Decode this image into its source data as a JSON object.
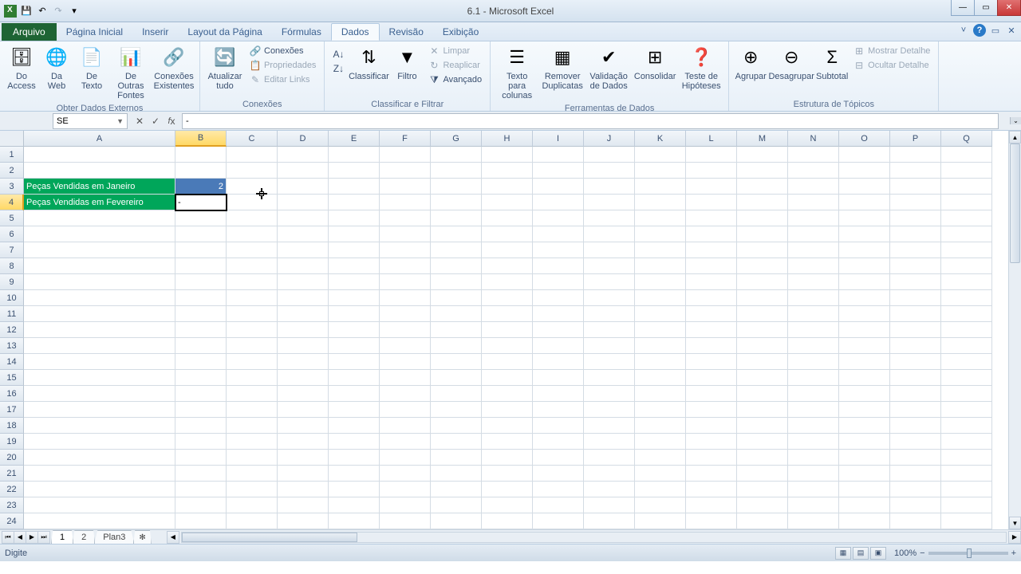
{
  "window": {
    "title": "6.1 - Microsoft Excel"
  },
  "qat": {
    "save": "💾",
    "undo": "↶",
    "redo": "↷"
  },
  "tabs": {
    "file": "Arquivo",
    "items": [
      "Página Inicial",
      "Inserir",
      "Layout da Página",
      "Fórmulas",
      "Dados",
      "Revisão",
      "Exibição"
    ],
    "active_index": 4
  },
  "ribbon": {
    "groups": [
      {
        "label": "Obter Dados Externos"
      },
      {
        "label": "Conexões"
      },
      {
        "label": "Classificar e Filtrar"
      },
      {
        "label": "Ferramentas de Dados"
      },
      {
        "label": "Estrutura de Tópicos"
      }
    ],
    "btns": {
      "do_access": "Do Access",
      "da_web": "Da Web",
      "de_texto": "De Texto",
      "de_outras": "De Outras Fontes",
      "conexoes_exist": "Conexões Existentes",
      "atualizar": "Atualizar tudo",
      "conexoes": "Conexões",
      "propriedades": "Propriedades",
      "editar_links": "Editar Links",
      "az": "A↓Z",
      "za": "Z↓A",
      "classificar": "Classificar",
      "filtro": "Filtro",
      "limpar": "Limpar",
      "reaplicar": "Reaplicar",
      "avancado": "Avançado",
      "texto_colunas": "Texto para colunas",
      "remover_dup": "Remover Duplicatas",
      "validacao": "Validação de Dados",
      "consolidar": "Consolidar",
      "teste_hip": "Teste de Hipóteses",
      "agrupar": "Agrupar",
      "desagrupar": "Desagrupar",
      "subtotal": "Subtotal",
      "mostrar_det": "Mostrar Detalhe",
      "ocultar_det": "Ocultar Detalhe"
    }
  },
  "formula_bar": {
    "name_box": "SE",
    "formula": "-"
  },
  "columns": [
    "A",
    "B",
    "C",
    "D",
    "E",
    "F",
    "G",
    "H",
    "I",
    "J",
    "K",
    "L",
    "M",
    "N",
    "O",
    "P",
    "Q"
  ],
  "col_widths": {
    "A": 190,
    "B": 64,
    "default": 64
  },
  "active_col": "B",
  "active_row": 4,
  "rows_visible": 24,
  "cells": {
    "A3": {
      "value": "Peças Vendidas em Janeiro",
      "style": "green"
    },
    "B3": {
      "value": "2",
      "style": "blue",
      "align": "right"
    },
    "A4": {
      "value": "Peças Vendidas em Fevereiro",
      "style": "green"
    },
    "B4": {
      "value": "-",
      "style": "edit"
    }
  },
  "sheet_tabs": {
    "items": [
      "1",
      "2",
      "Plan3"
    ],
    "active_index": 0
  },
  "status": {
    "mode": "Digite",
    "zoom": "100%"
  }
}
